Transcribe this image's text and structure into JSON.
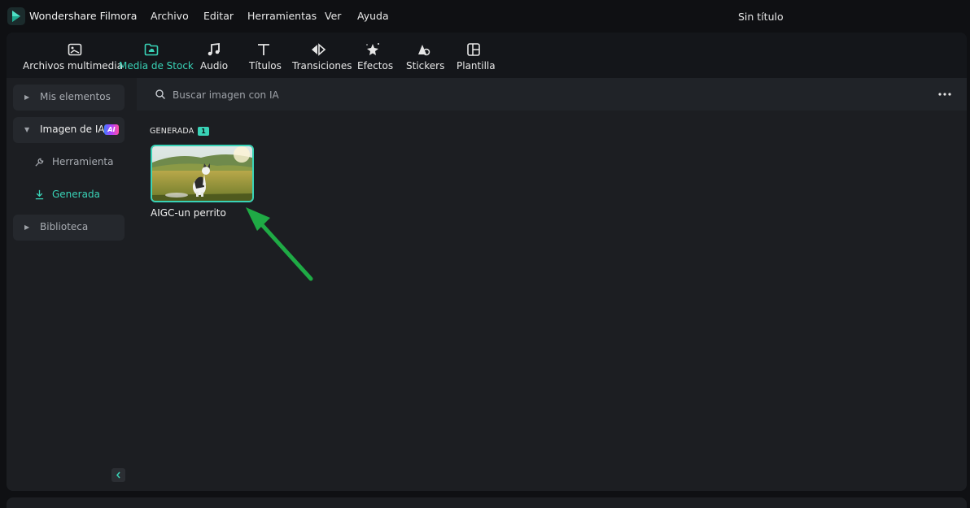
{
  "app": {
    "name": "Wondershare Filmora",
    "document_title": "Sin título",
    "accent_color": "#39d3b7"
  },
  "menu": {
    "items": [
      "Archivo",
      "Editar",
      "Herramientas",
      "Ver",
      "Ayuda"
    ]
  },
  "toolbar": {
    "tabs": [
      {
        "label": "Archivos multimedia",
        "icon": "media-files-icon",
        "active": false
      },
      {
        "label": "Media de Stock",
        "icon": "stock-media-icon",
        "active": true
      },
      {
        "label": "Audio",
        "icon": "music-note-icon",
        "active": false
      },
      {
        "label": "Títulos",
        "icon": "text-icon",
        "active": false
      },
      {
        "label": "Transiciones",
        "icon": "transitions-icon",
        "active": false
      },
      {
        "label": "Efectos",
        "icon": "effects-icon",
        "active": false
      },
      {
        "label": "Stickers",
        "icon": "stickers-icon",
        "active": false
      },
      {
        "label": "Plantilla",
        "icon": "template-icon",
        "active": false
      }
    ]
  },
  "sidebar": {
    "my_items": "Mis elementos",
    "ai_image": "Imagen de IA",
    "ai_badge": "AI",
    "tool": "Herramienta",
    "generated": "Generada",
    "library": "Biblioteca"
  },
  "search": {
    "placeholder": "Buscar imagen con IA"
  },
  "content": {
    "section_label": "GENERADA",
    "section_count": "1",
    "items": [
      {
        "label": "AIGC-un perrito",
        "selected": true
      }
    ]
  }
}
